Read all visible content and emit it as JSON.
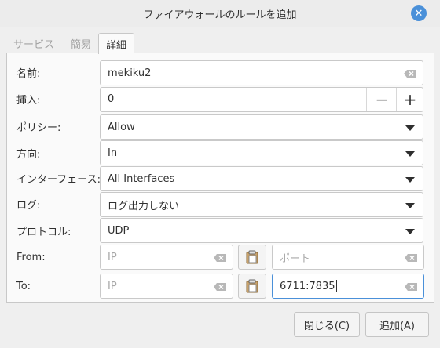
{
  "window": {
    "title": "ファイアウォールのルールを追加"
  },
  "tabs": [
    {
      "label": "サービス",
      "active": false
    },
    {
      "label": "簡易",
      "active": false
    },
    {
      "label": "詳細",
      "active": true
    }
  ],
  "form": {
    "name": {
      "label": "名前:",
      "value": "mekiku2"
    },
    "insert": {
      "label": "挿入:",
      "value": "0",
      "minus": "−",
      "plus": "+"
    },
    "policy": {
      "label": "ポリシー:",
      "value": "Allow"
    },
    "direction": {
      "label": "方向:",
      "value": "In"
    },
    "interface": {
      "label": "インターフェース:",
      "value": "All Interfaces"
    },
    "log": {
      "label": "ログ:",
      "value": "ログ出力しない"
    },
    "protocol": {
      "label": "プロトコル:",
      "value": "UDP"
    },
    "from": {
      "label": "From:",
      "ip_placeholder": "IP",
      "port_placeholder": "ポート",
      "ip_value": "",
      "port_value": ""
    },
    "to": {
      "label": "To:",
      "ip_placeholder": "IP",
      "port_value": "6711:7835"
    }
  },
  "buttons": {
    "close": "閉じる(C)",
    "add": "追加(A)"
  },
  "colors": {
    "accent": "#4a90d9",
    "window_bg": "#efefef",
    "panel_bg": "#fafafa"
  }
}
